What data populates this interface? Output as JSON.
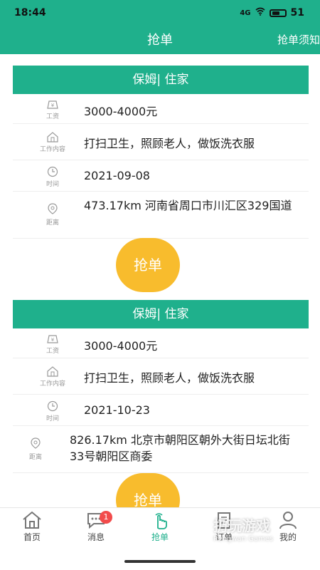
{
  "status": {
    "time": "18:44",
    "signal": "4G",
    "battery": "51"
  },
  "header": {
    "title": "抢单",
    "notice": "抢单须知"
  },
  "labels": {
    "salary": "工资",
    "work": "工作内容",
    "time": "时间",
    "distance": "距离"
  },
  "orders": [
    {
      "title": "保姆| 住家",
      "salary": "3000-4000元",
      "work": "打扫卫生，照顾老人，做饭洗衣服",
      "date": "2021-09-08",
      "location": "473.17km 河南省周口市川汇区329国道",
      "button": "抢单"
    },
    {
      "title": "保姆| 住家",
      "salary": "3000-4000元",
      "work": "打扫卫生，照顾老人，做饭洗衣服",
      "date": "2021-10-23",
      "location": "826.17km 北京市朝阳区朝外大街日坛北街33号朝阳区商委",
      "button": "抢单"
    }
  ],
  "tabs": [
    {
      "label": "首页",
      "icon": "home-icon"
    },
    {
      "label": "消息",
      "icon": "chat-icon",
      "badge": "1"
    },
    {
      "label": "抢单",
      "icon": "tap-icon",
      "active": true
    },
    {
      "label": "订单",
      "icon": "clipboard-icon"
    },
    {
      "label": "我的",
      "icon": "user-icon"
    }
  ],
  "watermark": {
    "text": "扔玩游戏",
    "sub": "Rengwan Games"
  },
  "colors": {
    "primary": "#1fb08c",
    "accent": "#f8bc2d",
    "salary": "#f5b427",
    "badge": "#f24b4b"
  }
}
